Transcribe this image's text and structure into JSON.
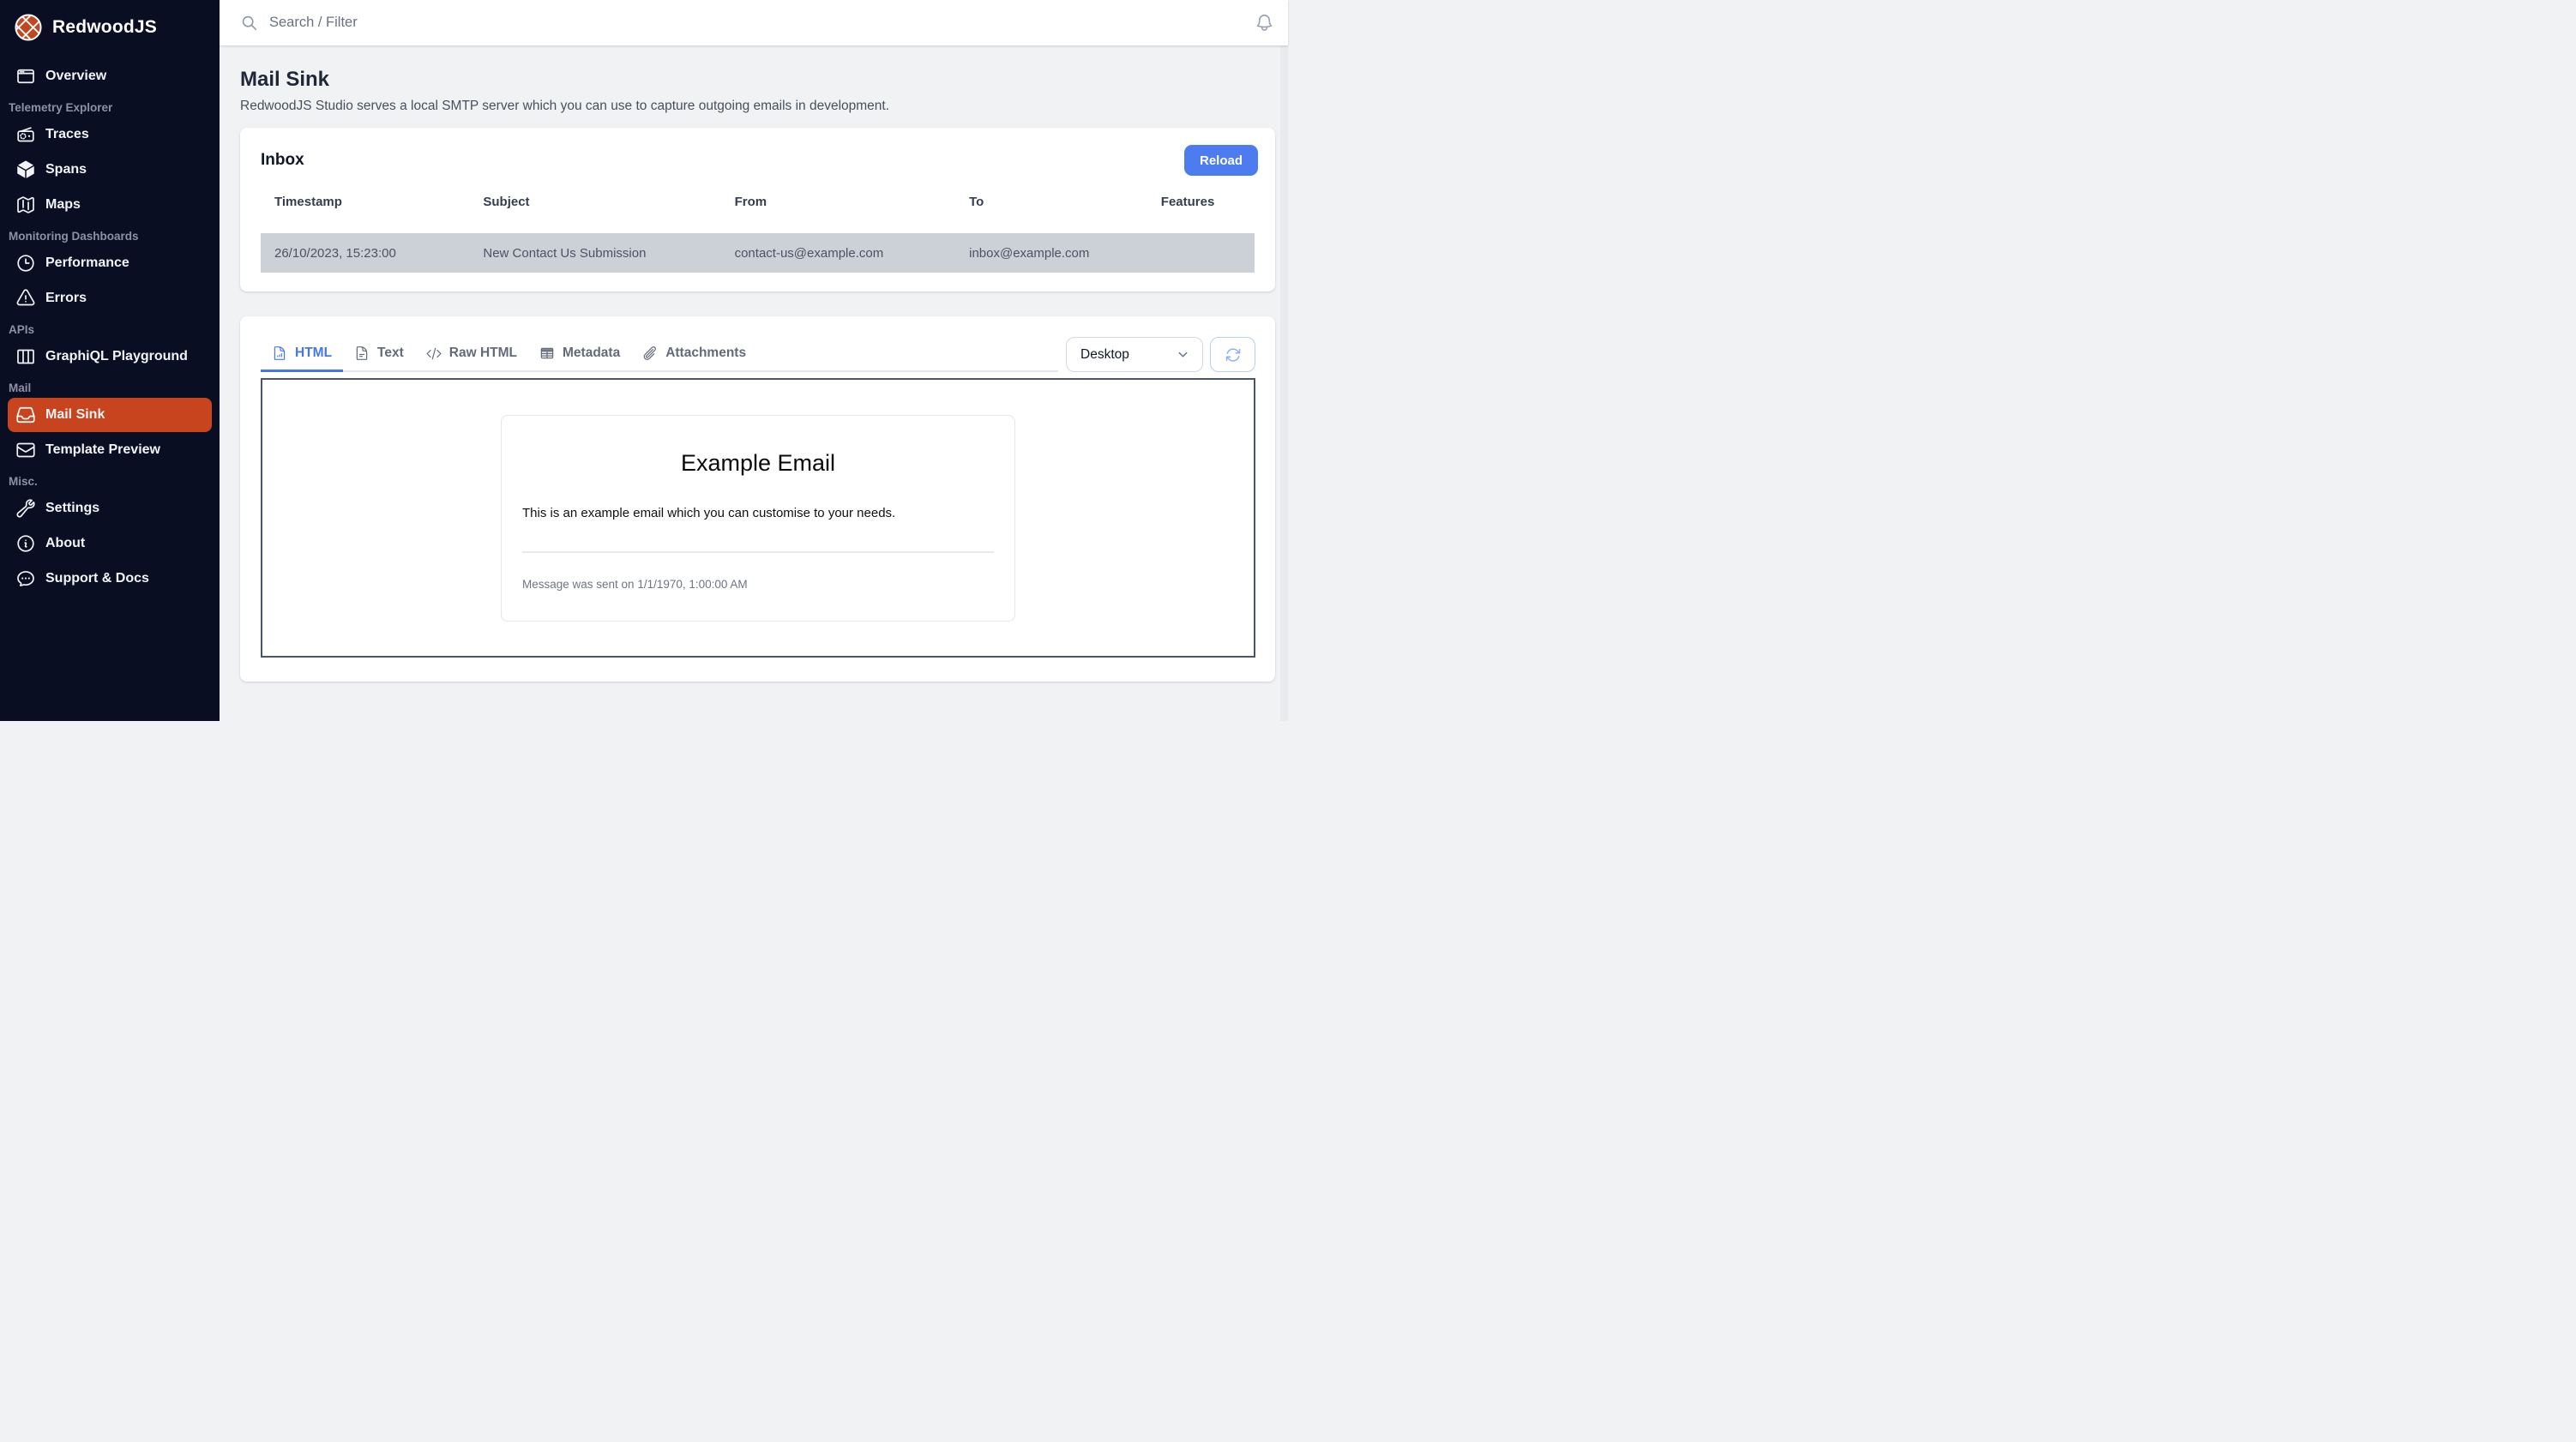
{
  "app": {
    "brand": "RedwoodJS"
  },
  "topbar": {
    "search_placeholder": "Search / Filter"
  },
  "sidebar": {
    "sections": {
      "telemetry": "Telemetry Explorer",
      "monitoring": "Monitoring Dashboards",
      "apis": "APIs",
      "mail": "Mail",
      "misc": "Misc."
    },
    "items": {
      "overview": "Overview",
      "traces": "Traces",
      "spans": "Spans",
      "maps": "Maps",
      "performance": "Performance",
      "errors": "Errors",
      "graphiql": "GraphiQL Playground",
      "mail_sink": "Mail Sink",
      "template_preview": "Template Preview",
      "settings": "Settings",
      "about": "About",
      "support": "Support & Docs"
    }
  },
  "page": {
    "title": "Mail Sink",
    "subtitle": "RedwoodJS Studio serves a local SMTP server which you can use to capture outgoing emails in development."
  },
  "inbox": {
    "title": "Inbox",
    "reload_label": "Reload",
    "columns": {
      "timestamp": "Timestamp",
      "subject": "Subject",
      "from": "From",
      "to": "To",
      "features": "Features"
    },
    "rows": [
      {
        "timestamp": "26/10/2023, 15:23:00",
        "subject": "New Contact Us Submission",
        "from": "contact-us@example.com",
        "to": "inbox@example.com",
        "features": ""
      }
    ]
  },
  "viewer": {
    "tabs": {
      "html": "HTML",
      "text": "Text",
      "raw_html": "Raw HTML",
      "metadata": "Metadata",
      "attachments": "Attachments"
    },
    "device_selector": {
      "value": "Desktop"
    },
    "email": {
      "title": "Example Email",
      "body": "This is an example email which you can customise to your needs.",
      "sent_note": "Message was sent on 1/1/1970, 1:00:00 AM"
    }
  },
  "colors": {
    "sidebar_bg": "#0a0e23",
    "active_nav_orange": "#c8441f",
    "brand_orange": "#bf4722",
    "accent_blue": "#4c7cf0",
    "selected_row_gray": "#ccd0d7",
    "content_bg": "#f1f2f4"
  }
}
